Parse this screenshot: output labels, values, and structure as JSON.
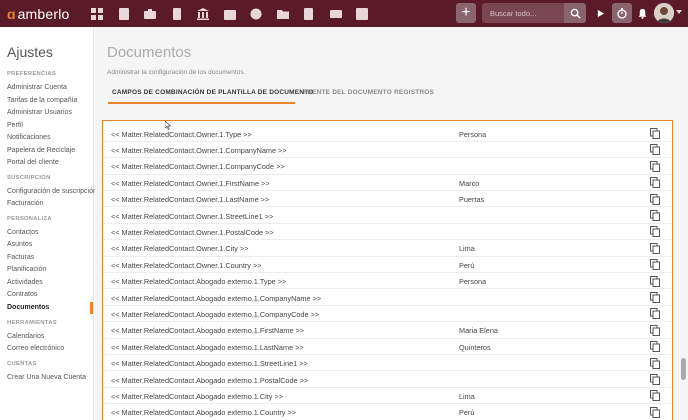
{
  "app": {
    "logo_text": "amberlo"
  },
  "topbar": {
    "nav_icons": [
      "dashboard-icon",
      "contacts-icon",
      "briefcase-icon",
      "invoice-icon",
      "bank-icon",
      "calendar-icon",
      "history-icon",
      "folder-icon",
      "document-edit-icon",
      "mail-icon",
      "reports-icon"
    ],
    "search_placeholder": "Buscar todo..."
  },
  "sidebar": {
    "title": "Ajustes",
    "sections": [
      {
        "label": "PREFERENCIAS",
        "items": [
          "Administrar Cuenta",
          "Tarifas de la compañía",
          "Administrar Usuarios",
          "Perfil",
          "Notificaciones",
          "Papelera de Reciclaje",
          "Portal del cliente"
        ]
      },
      {
        "label": "SUSCRIPCIÓN",
        "items": [
          "Configuración de suscripción",
          "Facturación"
        ]
      },
      {
        "label": "PERSONALIZA",
        "items": [
          "Contactos",
          "Asuntos",
          "Facturas",
          "Planificación",
          "Actividades",
          "Contratos",
          "Documentos"
        ]
      },
      {
        "label": "HERRAMIENTAS",
        "items": [
          "Calendarios",
          "Correo electrónico"
        ]
      },
      {
        "label": "CUENTAS",
        "items": [
          "Crear Una Nueva Cuenta"
        ]
      }
    ],
    "active_item": "Documentos"
  },
  "main": {
    "title": "Documentos",
    "subtitle": "Administrar la configuración de los documentos.",
    "tabs": [
      {
        "label": "CAMPOS DE COMBINACIÓN DE PLANTILLA DE DOCUMENTO",
        "active": true
      },
      {
        "label": "FUENTE DEL DOCUMENTO",
        "active": false
      },
      {
        "label": "REGISTROS",
        "active": false
      }
    ],
    "rows": [
      {
        "field": "<< Matter.RelatedContact.Owner.1.Type >>",
        "value": "Persona"
      },
      {
        "field": "<< Matter.RelatedContact.Owner.1.CompanyName >>",
        "value": ""
      },
      {
        "field": "<< Matter.RelatedContact.Owner.1.CompanyCode >>",
        "value": ""
      },
      {
        "field": "<< Matter.RelatedContact.Owner.1.FirstName >>",
        "value": "Marco"
      },
      {
        "field": "<< Matter.RelatedContact.Owner.1.LastName >>",
        "value": "Puertas"
      },
      {
        "field": "<< Matter.RelatedContact.Owner.1.StreetLine1 >>",
        "value": ""
      },
      {
        "field": "<< Matter.RelatedContact.Owner.1.PostalCode >>",
        "value": ""
      },
      {
        "field": "<< Matter.RelatedContact.Owner.1.City >>",
        "value": "Lima"
      },
      {
        "field": "<< Matter.RelatedContact.Owner.1.Country >>",
        "value": "Perú"
      },
      {
        "field": "<< Matter.RelatedContact.Abogado externo.1.Type >>",
        "value": "Persona"
      },
      {
        "field": "<< Matter.RelatedContact.Abogado externo.1.CompanyName >>",
        "value": ""
      },
      {
        "field": "<< Matter.RelatedContact.Abogado externo.1.CompanyCode >>",
        "value": ""
      },
      {
        "field": "<< Matter.RelatedContact.Abogado externo.1.FirstName >>",
        "value": "Maria Elena"
      },
      {
        "field": "<< Matter.RelatedContact.Abogado externo.1.LastName >>",
        "value": "Quinteros"
      },
      {
        "field": "<< Matter.RelatedContact.Abogado externo.1.StreetLine1 >>",
        "value": ""
      },
      {
        "field": "<< Matter.RelatedContact.Abogado externo.1.PostalCode >>",
        "value": ""
      },
      {
        "field": "<< Matter.RelatedContact.Abogado externo.1.City >>",
        "value": "Lima"
      },
      {
        "field": "<< Matter.RelatedContact.Abogado externo.1.Country >>",
        "value": "Perú"
      }
    ]
  },
  "colors": {
    "topbar": "#5b1a2a",
    "accent": "#e8842c",
    "panel_border": "#e8842c"
  }
}
